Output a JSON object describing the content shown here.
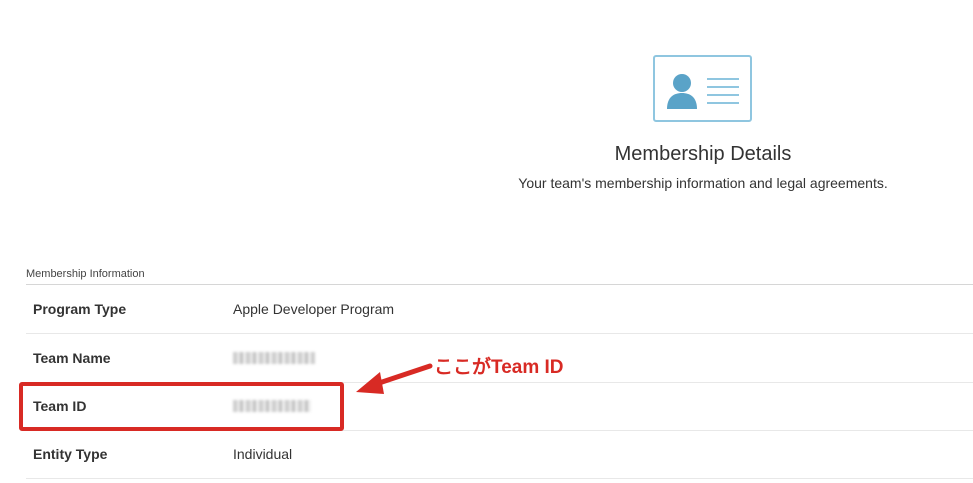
{
  "header": {
    "title": "Membership Details",
    "subtitle": "Your team's membership information and legal agreements.",
    "icon": "id-card-icon"
  },
  "section": {
    "heading": "Membership Information",
    "rows": [
      {
        "label": "Program Type",
        "value": "Apple Developer Program",
        "redacted": false
      },
      {
        "label": "Team Name",
        "value": "",
        "redacted": true
      },
      {
        "label": "Team ID",
        "value": "",
        "redacted": true
      },
      {
        "label": "Entity Type",
        "value": "Individual",
        "redacted": false
      }
    ]
  },
  "annotation": {
    "text": "ここがTeam ID",
    "color": "#d82a24"
  },
  "colors": {
    "icon_accent": "#5aa3c8",
    "icon_border": "#8fc6e0",
    "annotation_red": "#d82a24"
  }
}
